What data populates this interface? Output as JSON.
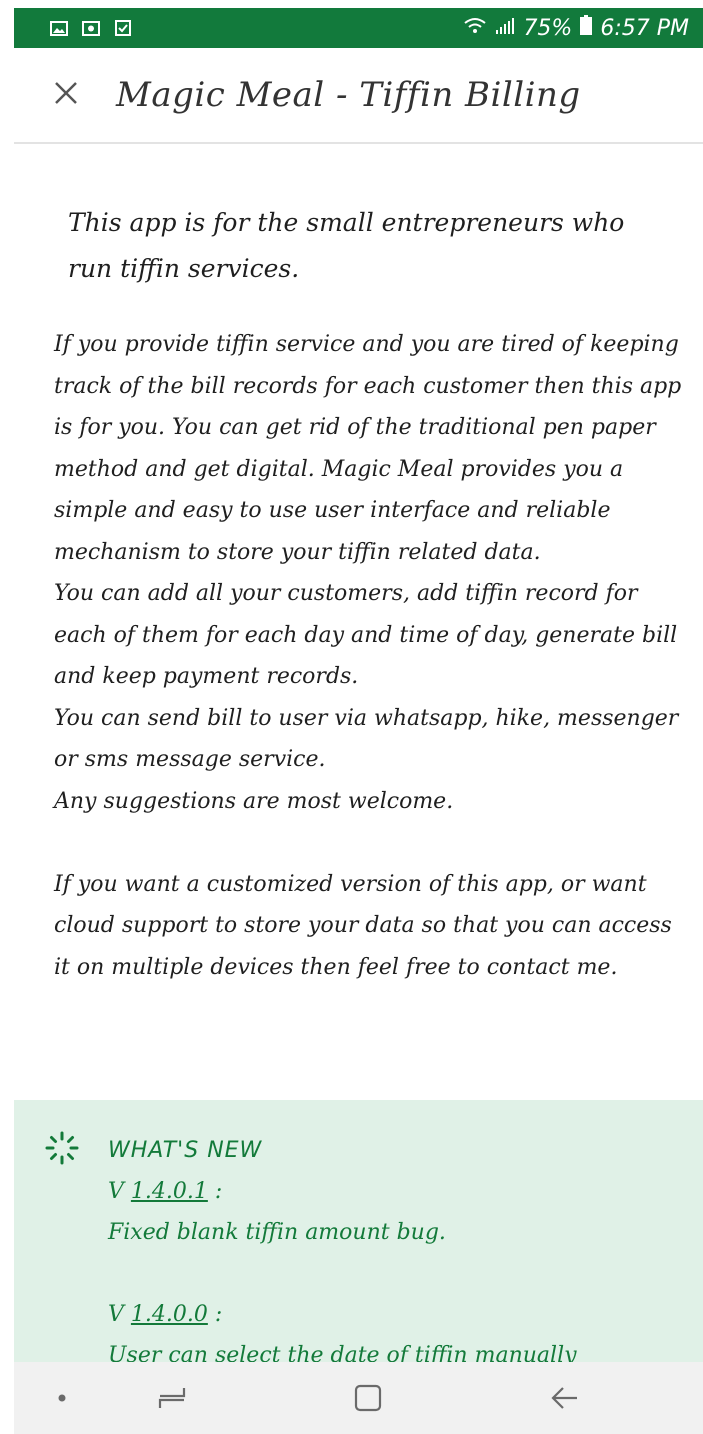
{
  "status_bar": {
    "battery_percent": "75%",
    "time": "6:57 PM",
    "icons": [
      "image-notification-icon",
      "photo-notification-icon",
      "checkbox-notification-icon",
      "wifi-icon",
      "signal-icon",
      "battery-icon"
    ],
    "background_color": "#127a3c"
  },
  "header": {
    "title": "Magic Meal - Tiffin Billing",
    "close_icon": "close-icon"
  },
  "content": {
    "tagline": "This app is for the small entrepreneurs who run tiffin services.",
    "description_paragraph_1": "If you provide tiffin service and you are tired of keeping track of the bill records for each customer then this app is for you. You can get rid of the traditional pen paper method and get digital. Magic Meal provides you a simple and easy to use user interface and reliable mechanism to store your tiffin related data.\nYou can add all your customers, add tiffin record for each of them for each day and time of day, generate bill and keep payment records.\nYou can send bill to user via whatsapp, hike, messenger or sms message service.\nAny suggestions are most welcome.",
    "description_paragraph_2": "If you want a customized version of this app, or want cloud support to store your data so that you can access it on multiple devices then feel free to contact me."
  },
  "whats_new": {
    "title": "WHAT'S NEW",
    "icon": "sparkle-icon",
    "background_color": "#e0f1e7",
    "text_color": "#137a3a",
    "releases": [
      {
        "prefix": "V ",
        "version": "1.4.0.1",
        "suffix": " :",
        "note": "Fixed blank tiffin amount bug."
      },
      {
        "prefix": "V ",
        "version": "1.4.0.0",
        "suffix": " :",
        "note": "User can select the date of tiffin manually"
      }
    ]
  },
  "nav_bar": {
    "icons": [
      "dot-icon",
      "recent-apps-icon",
      "home-icon",
      "back-icon"
    ]
  }
}
